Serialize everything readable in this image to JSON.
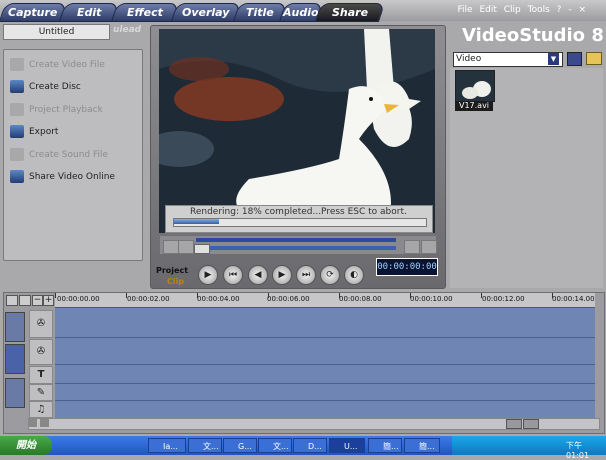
{
  "tabs": [
    {
      "label": "Capture",
      "active": false
    },
    {
      "label": "Edit",
      "active": false
    },
    {
      "label": "Effect",
      "active": false
    },
    {
      "label": "Overlay",
      "active": false
    },
    {
      "label": "Title",
      "active": false
    },
    {
      "label": "Audio",
      "active": false
    },
    {
      "label": "Share",
      "active": true
    }
  ],
  "menu": {
    "file": "File",
    "edit": "Edit",
    "clip": "Clip",
    "tools": "Tools",
    "help": "?",
    "minimize": "-",
    "close": "×"
  },
  "project": {
    "title": "Untitled",
    "logo": "ulead"
  },
  "share_panel": {
    "items": [
      {
        "label": "Create Video File",
        "enabled": false,
        "icon": "film-reel-icon"
      },
      {
        "label": "Create Disc",
        "enabled": true,
        "icon": "disc-icon"
      },
      {
        "label": "Project Playback",
        "enabled": false,
        "icon": "monitor-icon"
      },
      {
        "label": "Export",
        "enabled": true,
        "icon": "export-icon"
      },
      {
        "label": "Create Sound File",
        "enabled": false,
        "icon": "sound-wave-icon"
      },
      {
        "label": "Share Video Online",
        "enabled": true,
        "icon": "globe-icon"
      }
    ]
  },
  "preview": {
    "render_status": "Rendering: 18% completed...Press ESC to abort.",
    "render_progress": 0.18,
    "mode_project": "Project",
    "mode_clip": "Clip",
    "timecode": "00:00:00:00"
  },
  "brand": "VideoStudio 8",
  "library": {
    "category": "Video",
    "clips": [
      {
        "name": "V17.avi"
      }
    ]
  },
  "timeline": {
    "ruler": [
      "00:00:00.00",
      "00:00:02.00",
      "00:00:04.00",
      "00:00:06.00",
      "00:00:08.00",
      "00:00:10.00",
      "00:00:12.00",
      "00:00:14.00"
    ]
  },
  "taskbar": {
    "start": "開始",
    "items": [
      "Ia...",
      "文...",
      "G...",
      "文...",
      "D...",
      "U...",
      "簡...",
      "簡..."
    ],
    "clock": "下午 01:01"
  },
  "colors": {
    "tab_active": "#1a1a1c",
    "tab": "#2e3c66",
    "track": "#6f85b3",
    "render_fill": "#2b61b2"
  }
}
